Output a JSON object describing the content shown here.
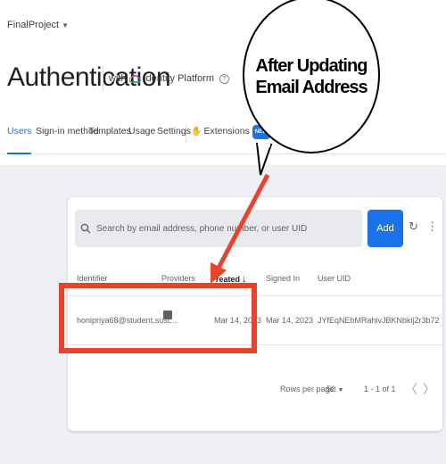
{
  "project": {
    "name": "FinalProject"
  },
  "page": {
    "title": "Authentication",
    "with_label": "with",
    "identity_platform": "Identity Platform",
    "help_glyph": "?"
  },
  "tabs": [
    {
      "label": "Users",
      "active": true
    },
    {
      "label": "Sign-in method"
    },
    {
      "label": "Templates"
    },
    {
      "label": "Usage"
    },
    {
      "label": "Settings"
    },
    {
      "label": "Extensions",
      "badge": "NEW"
    }
  ],
  "search": {
    "placeholder": "Search by email address, phone number, or user UID"
  },
  "toolbar": {
    "add_user": "Add user"
  },
  "table": {
    "headers": [
      "Identifier",
      "Providers",
      "Created",
      "Signed In",
      "User UID"
    ],
    "sorted_column": "Created",
    "visible_headers": [
      "Identifier",
      "Providers",
      "reated",
      "Signed In",
      "User UID"
    ],
    "rows": [
      {
        "identifier": "honipriya68@student.sust....",
        "provider": "email-icon",
        "created": "Mar 14, 2023",
        "signed_in": "Mar 14, 2023",
        "uid": "JYfEqNEbMRahivJBKNbkij2r3b72"
      }
    ]
  },
  "pagination": {
    "rows_per_page_label": "Rows per page:",
    "rows_per_page_value": "50",
    "range": "1 - 1 of 1"
  },
  "annotation": {
    "line1": "After Updating",
    "line2": "Email Address",
    "highlight_color": "#e8432b",
    "arrow_color": "#e8432b"
  },
  "colors": {
    "accent": "#1a73e8",
    "annotation": "#e8432b"
  }
}
